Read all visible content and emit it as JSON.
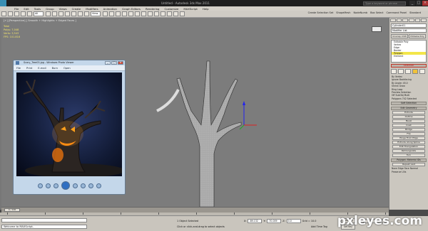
{
  "window": {
    "title": "Untitled - Autodesk 3ds Max 2011",
    "search_placeholder": "Type a keyword or phrase",
    "min_icon": "minimize-icon",
    "max_icon": "maximize-icon",
    "close_icon": "close-icon"
  },
  "menu": {
    "items": [
      "File",
      "Edit",
      "Tools",
      "Group",
      "Views",
      "Create",
      "Modifiers",
      "Animation",
      "Graph Editors",
      "Rendering",
      "Customize",
      "MAXScript",
      "Help"
    ]
  },
  "toolbar": {
    "selection_filter": "All",
    "ref_coord": "View",
    "right_labels": [
      "Create Selection Set",
      "ShapeMesh",
      "NodeNumb",
      "Box Select",
      "Command Panel",
      "Standard"
    ]
  },
  "viewport": {
    "label": "[+] [Perspective] [ Smooth + Highlights + Edged Faces ]",
    "stats": [
      "Total",
      "Polys: 7,048",
      "Verts: 3,543",
      "",
      "FPS: 101.816"
    ]
  },
  "viewer": {
    "title": "Scary_Tree03.jpg - Windows Photo Viewer",
    "menu": [
      "File",
      "Print",
      "E-mail",
      "Burn",
      "Open"
    ]
  },
  "command_panel": {
    "object_name": "Cylinder01",
    "modifier_list": "Modifier List",
    "top_buttons": [
      "Unwrap UVW",
      "Editable Poly"
    ],
    "stack": [
      "Editable Poly",
      "Vertex",
      "Edge",
      "Border",
      "Polygon",
      "Element"
    ],
    "selected_stack_item": "Polygon",
    "selection_rollout": "Selection",
    "selection_options": [
      "By Vertex",
      "Ignore Backfacing",
      "By Angle: 45.0",
      "Shrink",
      "Grow",
      "Ring",
      "Loop",
      "Preview Selection",
      "Off  SubObj  Multi",
      "Polygons 742 Selected"
    ],
    "soft_selection": "Soft Selection",
    "edit_geometry": "Edit Geometry",
    "edit_buttons": [
      "Extrude",
      "Outline",
      "Bevel",
      "Inset",
      "Bridge",
      "Flip",
      "Hinge From Edge",
      "Extrude Along Spline",
      "Edit Triangulation",
      "Retriangulate",
      "Turn"
    ],
    "polygon_rollout": "Polygon: Material IDs",
    "repeat_last": "Repeat Last",
    "constraints": [
      "None",
      "Edge",
      "Face",
      "Normal"
    ],
    "preserve_uvs": "Preserve UVs"
  },
  "timeline": {
    "slider": "0 / 100",
    "ruler_marks": [
      "0",
      "10",
      "20",
      "30",
      "40",
      "50",
      "60",
      "70",
      "80",
      "90",
      "100"
    ]
  },
  "status": {
    "welcome": "Welcome to MAXScript.",
    "selection": "1 Object Selected",
    "prompt": "Click or click-and-drag to select objects",
    "x_label": "X:",
    "x_value": "-89.132",
    "y_label": "Y:",
    "y_value": "-70.009",
    "z_label": "Z:",
    "z_value": "0.0",
    "grid": "Grid = 10.0",
    "add_time_tag": "Add Time Tag",
    "auto_key": "Auto Key",
    "set_key": "Set Key",
    "selected": "Selected"
  },
  "watermark": "pxleyes.com"
}
